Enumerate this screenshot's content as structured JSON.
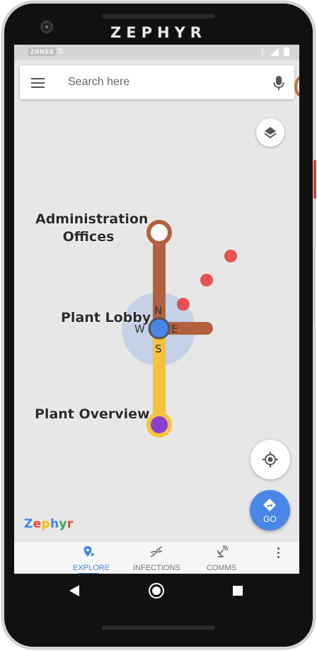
{
  "device": {
    "brand": "ZEPHYR"
  },
  "status_bar": {
    "carrier": "ZRNSS",
    "data_icon": "data-arrows-icon",
    "icons": [
      "bluetooth-icon",
      "signal-icon",
      "battery-icon"
    ]
  },
  "search": {
    "placeholder": "Search here"
  },
  "map": {
    "locations": [
      {
        "id": "administration-offices",
        "label_lines": [
          "Administration",
          "Offices"
        ]
      },
      {
        "id": "plant-lobby",
        "label": "Plant Lobby"
      },
      {
        "id": "plant-overview",
        "label": "Plant Overview"
      }
    ],
    "compass": {
      "n": "N",
      "s": "S",
      "e": "E",
      "w": "W"
    },
    "colors": {
      "route_brown": "#b4603f",
      "route_yellow": "#f9c23c",
      "marker_purple": "#8a3fd1",
      "user_blue": "#4a86e8",
      "infection_red": "#e53935"
    }
  },
  "controls": {
    "go_label": "GO"
  },
  "logo": {
    "letters": [
      "Z",
      "e",
      "p",
      "h",
      "y",
      "r"
    ],
    "colors": [
      "#4285f4",
      "#ea4335",
      "#fbbc05",
      "#4285f4",
      "#34a853",
      "#ea4335"
    ]
  },
  "bottom_nav": {
    "items": [
      {
        "label": "EXPLORE",
        "icon": "map-pin-icon",
        "active": true
      },
      {
        "label": "INFECTIONS",
        "icon": "dna-icon",
        "active": false
      },
      {
        "label": "COMMS",
        "icon": "satellite-dish-icon",
        "active": false
      }
    ]
  }
}
